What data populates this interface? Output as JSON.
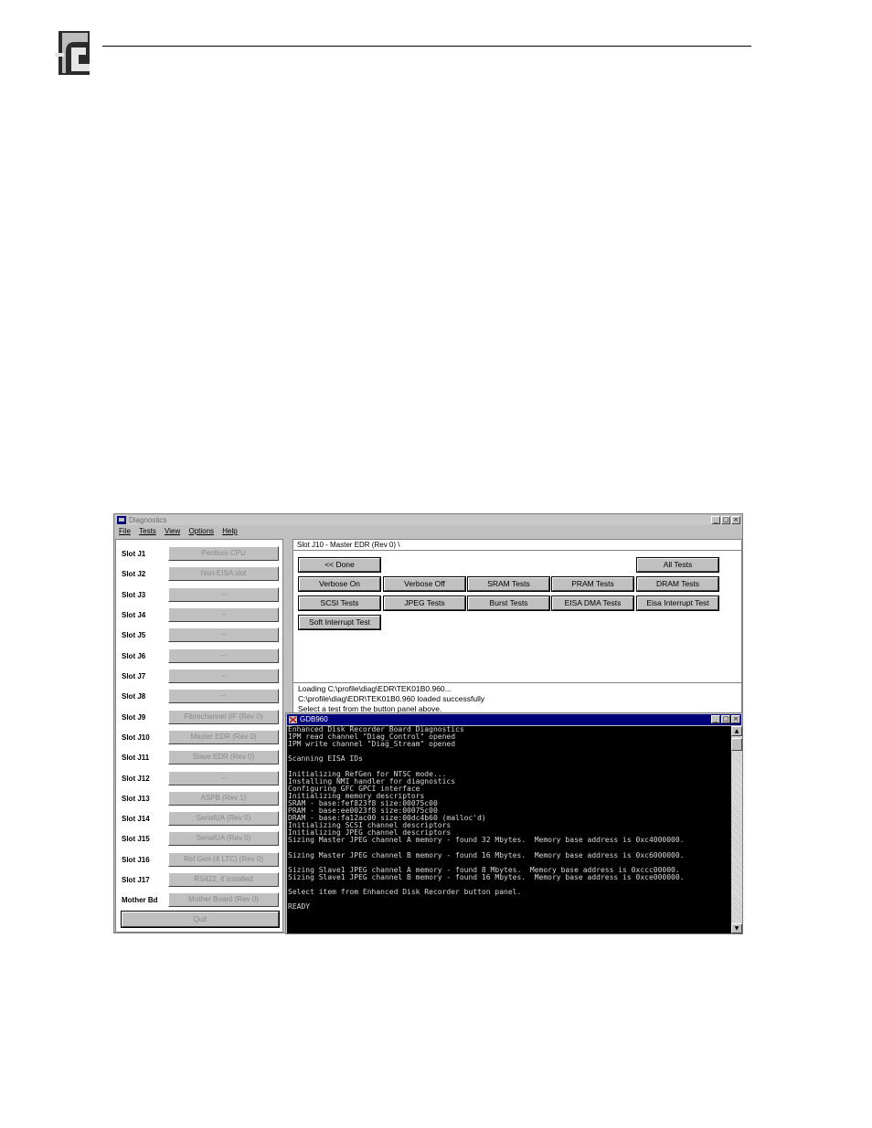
{
  "diagnostics_window": {
    "title": "Diagnostics",
    "menu": [
      "File",
      "Tests",
      "View",
      "Options",
      "Help"
    ],
    "window_buttons": [
      "_",
      "□",
      "×"
    ],
    "slots": [
      {
        "label": "Slot J1",
        "value": "Pentium CPU"
      },
      {
        "label": "Slot J2",
        "value": "Non-EISA slot"
      },
      {
        "label": "Slot J3",
        "value": "--"
      },
      {
        "label": "Slot J4",
        "value": "--"
      },
      {
        "label": "Slot J5",
        "value": "--"
      },
      {
        "label": "Slot J6",
        "value": "--"
      },
      {
        "label": "Slot J7",
        "value": "--"
      },
      {
        "label": "Slot J8",
        "value": "--"
      },
      {
        "label": "Slot J9",
        "value": "Fibrechannel I/F (Rev 0)"
      },
      {
        "label": "Slot J10",
        "value": "Master EDR (Rev 0)"
      },
      {
        "label": "Slot J11",
        "value": "Slave EDR (Rev 0)"
      },
      {
        "label": "Slot J12",
        "value": "--"
      },
      {
        "label": "Slot J13",
        "value": "ASPB (Rev 1)"
      },
      {
        "label": "Slot J14",
        "value": "SerialUA (Rev 0)"
      },
      {
        "label": "Slot J15",
        "value": "SerialUA (Rev 0)"
      },
      {
        "label": "Slot J16",
        "value": "Ref Gen (4 LTC) (Rev 0)"
      },
      {
        "label": "Slot J17",
        "value": "RS422, if installed"
      },
      {
        "label": "Mother Bd",
        "value": "Mother Board (Rev 0)"
      }
    ],
    "quit_label": "Quit",
    "slot_title": "Slot J10 - Master EDR (Rev 0) \\",
    "test_buttons": {
      "done": "<< Done",
      "all": "All Tests",
      "verbose_on": "Verbose On",
      "verbose_off": "Verbose Off",
      "sram": "SRAM Tests",
      "pram": "PRAM Tests",
      "dram": "DRAM Tests",
      "scsi": "SCSI Tests",
      "jpeg": "JPEG Tests",
      "burst": "Burst Tests",
      "eisa_dma": "EISA DMA Tests",
      "eisa_interrupt": "Eisa Interrupt Test",
      "soft_interrupt": "Soft Interrupt Test"
    },
    "status_lines": [
      "Loading C:\\profile\\diag\\EDR\\TEK01B0.960...",
      "C:\\profile\\diag\\EDR\\TEK01B0.960 loaded successfully",
      "Select a test from the button panel above."
    ]
  },
  "console_window": {
    "title": "GDB960",
    "window_buttons": [
      "_",
      "□",
      "×"
    ],
    "lines": [
      "Enhanced Disk Recorder Board Diagnostics",
      "IPM read channel \"Diag_Control\" opened",
      "IPM write channel \"Diag_Stream\" opened",
      "",
      "Scanning EISA IDs",
      "",
      "Initializing RefGen for NTSC mode...",
      "Installing NMI handler for diagnostics",
      "Configuring GFC GPCI interface",
      "Initializing memory descriptors",
      "SRAM - base:fef823f8 size:00075c00",
      "PRAM - base:ee0023f8 size:00075c00",
      "DRAM - base:fa12ac00 size:00dc4b60 (malloc'd)",
      "Initializing SCSI channel descriptors",
      "Initializing JPEG channel descriptors",
      "Sizing Master JPEG channel A memory - found 32 Mbytes.  Memory base address is 0xc4000000.",
      "",
      "Sizing Master JPEG channel B memory - found 16 Mbytes.  Memory base address is 0xc6000000.",
      "",
      "Sizing Slave1 JPEG channel A memory - found 8 Mbytes.  Memory base address is 0xccc00000.",
      "Sizing Slave1 JPEG channel B memory - found 16 Mbytes.  Memory base address is 0xce000000.",
      "",
      "Select item from Enhanced Disk Recorder button panel.",
      "",
      "READY"
    ]
  }
}
